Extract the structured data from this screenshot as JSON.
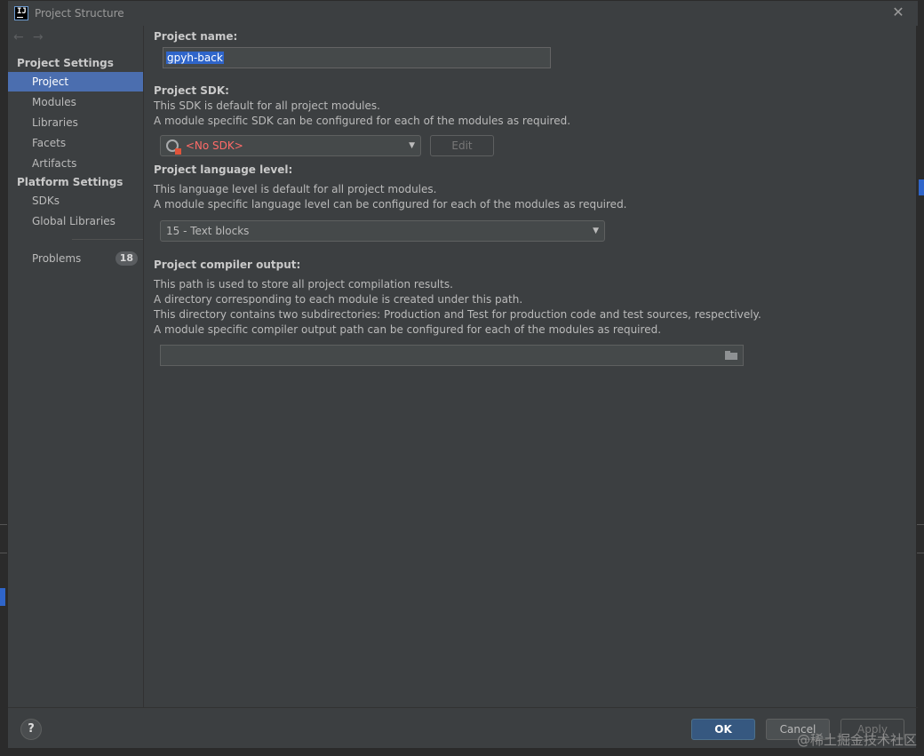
{
  "window": {
    "title": "Project Structure",
    "close_glyph": "✕"
  },
  "nav": {
    "back_glyph": "←",
    "forward_glyph": "→"
  },
  "sidebar": {
    "project_settings_header": "Project Settings",
    "project_settings_items": [
      {
        "label": "Project",
        "selected": true
      },
      {
        "label": "Modules"
      },
      {
        "label": "Libraries"
      },
      {
        "label": "Facets"
      },
      {
        "label": "Artifacts"
      }
    ],
    "platform_settings_header": "Platform Settings",
    "platform_settings_items": [
      {
        "label": "SDKs"
      },
      {
        "label": "Global Libraries"
      }
    ],
    "problems": {
      "label": "Problems",
      "count": "18"
    }
  },
  "project_name": {
    "label": "Project name:",
    "value": "gpyh-back"
  },
  "project_sdk": {
    "label": "Project SDK:",
    "desc1": "This SDK is default for all project modules.",
    "desc2": "A module specific SDK can be configured for each of the modules as required.",
    "selected": "<No SDK>",
    "edit_label": "Edit"
  },
  "language_level": {
    "label": "Project language level:",
    "desc1": "This language level is default for all project modules.",
    "desc2": "A module specific language level can be configured for each of the modules as required.",
    "selected": "15 - Text blocks"
  },
  "compiler_output": {
    "label": "Project compiler output:",
    "desc1": "This path is used to store all project compilation results.",
    "desc2": "A directory corresponding to each module is created under this path.",
    "desc3": "This directory contains two subdirectories: Production and Test for production code and test sources, respectively.",
    "desc4": "A module specific compiler output path can be configured for each of the modules as required.",
    "path": ""
  },
  "footer": {
    "help_glyph": "?",
    "ok_label": "OK",
    "cancel_label": "Cancel",
    "apply_label": "Apply"
  },
  "watermark": "@稀土掘金技术社区",
  "colors": {
    "accent": "#4b6eaf",
    "ok_button": "#365880",
    "error_text": "#ff6b68"
  }
}
